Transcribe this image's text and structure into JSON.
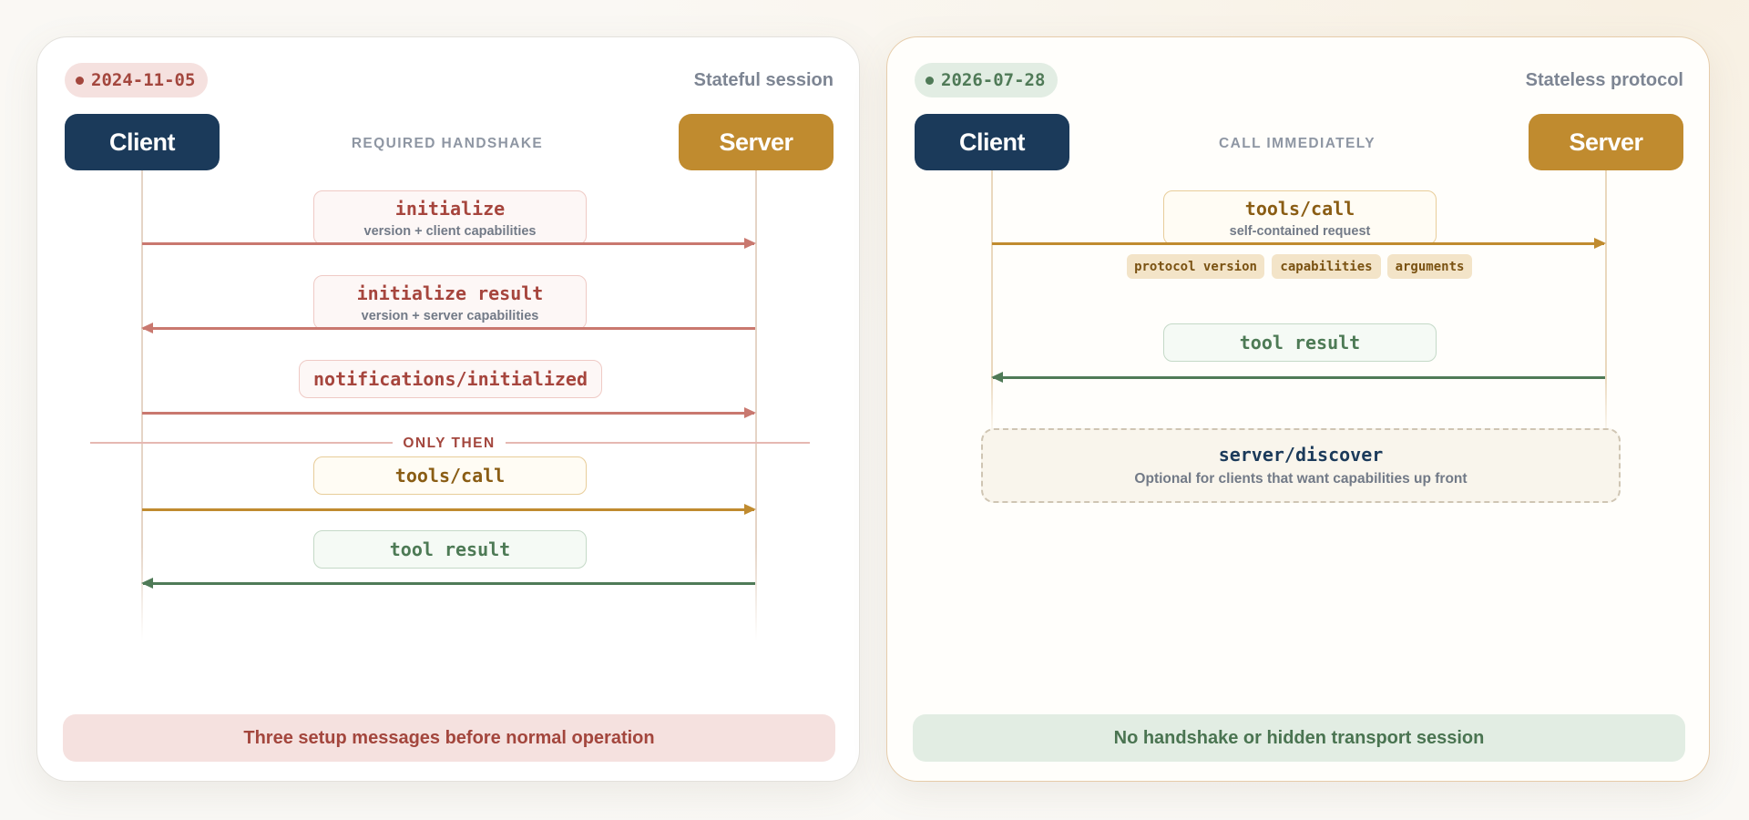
{
  "left": {
    "date": "2024-11-05",
    "title": "Stateful session",
    "client_label": "Client",
    "server_label": "Server",
    "mid_label": "REQUIRED HANDSHAKE",
    "messages": [
      {
        "label": "initialize",
        "sub": "version + client capabilities",
        "direction": "client-to-server"
      },
      {
        "label": "initialize result",
        "sub": "version + server capabilities",
        "direction": "server-to-client"
      },
      {
        "label": "notifications/initialized",
        "direction": "client-to-server"
      },
      {
        "label": "tools/call",
        "direction": "client-to-server"
      },
      {
        "label": "tool result",
        "direction": "server-to-client"
      }
    ],
    "divider_label": "ONLY THEN",
    "footer": "Three setup messages before normal operation"
  },
  "right": {
    "date": "2026-07-28",
    "title": "Stateless protocol",
    "client_label": "Client",
    "server_label": "Server",
    "mid_label": "CALL IMMEDIATELY",
    "messages": [
      {
        "label": "tools/call",
        "sub": "self-contained request",
        "direction": "client-to-server"
      },
      {
        "label": "tool result",
        "direction": "server-to-client"
      }
    ],
    "chips": [
      "protocol version",
      "capabilities",
      "arguments"
    ],
    "discover": {
      "label": "server/discover",
      "sub": "Optional for clients that want capabilities up front"
    },
    "footer": "No handshake or hidden transport session"
  },
  "colors": {
    "client": "#1b3a5a",
    "server": "#c08b2f",
    "handshake": "#a3463d",
    "call": "#c08b2f",
    "result": "#4f7a57"
  }
}
